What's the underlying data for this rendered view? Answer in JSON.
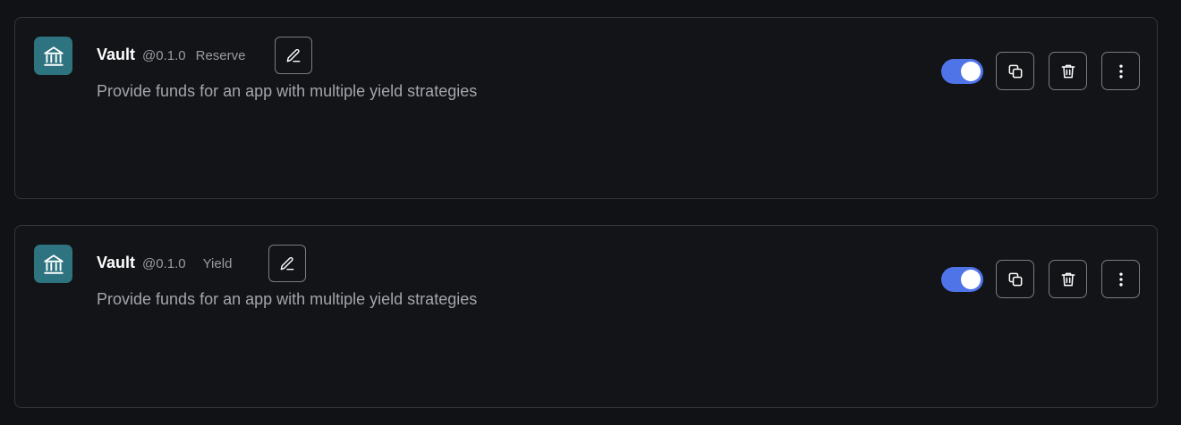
{
  "cards": [
    {
      "title": "Vault",
      "version": "@0.1.0",
      "tag": "Reserve",
      "description": "Provide funds for an app with multiple yield strategies",
      "enabled": true
    },
    {
      "title": "Vault",
      "version": "@0.1.0",
      "tag": "Yield",
      "description": "Provide funds for an app with multiple yield strategies",
      "enabled": true
    }
  ],
  "colors": {
    "background": "#111216",
    "card_border": "#34363c",
    "icon_bg": "#2e7380",
    "toggle_on": "#4f74e8",
    "muted_text": "#9a9ca3"
  },
  "icons": {
    "app": "bank-icon",
    "edit": "pencil-icon",
    "copy": "copy-icon",
    "delete": "trash-icon",
    "more": "more-vertical-icon"
  }
}
